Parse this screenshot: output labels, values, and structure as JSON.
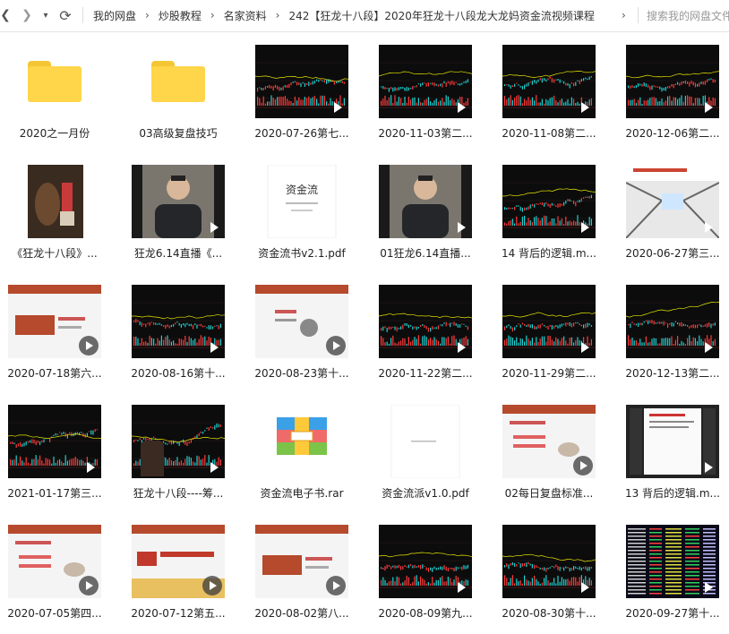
{
  "toolbar": {
    "back_icon": "chevron-left-icon",
    "forward_icon": "chevron-right-icon",
    "dropdown_icon": "triangle-down-icon",
    "refresh_icon": "refresh-icon",
    "breadcrumb": [
      "我的网盘",
      "炒股教程",
      "名家资料",
      "242【狂龙十八段】2020年狂龙十八段龙大龙妈资金流视频课程"
    ],
    "search_placeholder": "搜索我的网盘文件"
  },
  "items": [
    {
      "label": "2020之一月份",
      "type": "folder"
    },
    {
      "label": "03高级复盘技巧",
      "type": "folder"
    },
    {
      "label": "2020-07-26第七...",
      "type": "chart"
    },
    {
      "label": "2020-11-03第二...",
      "type": "chart"
    },
    {
      "label": "2020-11-08第二...",
      "type": "chart"
    },
    {
      "label": "2020-12-06第二...",
      "type": "chart"
    },
    {
      "label": "《狂龙十八段》...",
      "type": "image"
    },
    {
      "label": "狂龙6.14直播《...",
      "type": "person"
    },
    {
      "label": "资金流书v2.1.pdf",
      "type": "pdf"
    },
    {
      "label": "01狂龙6.14直播...",
      "type": "person"
    },
    {
      "label": "14 背后的逻辑.m...",
      "type": "chart"
    },
    {
      "label": "2020-06-27第三...",
      "type": "image2"
    },
    {
      "label": "2020-07-18第六...",
      "type": "ppt"
    },
    {
      "label": "2020-08-16第十...",
      "type": "chart"
    },
    {
      "label": "2020-08-23第十...",
      "type": "ppt2"
    },
    {
      "label": "2020-11-22第二...",
      "type": "chart"
    },
    {
      "label": "2020-11-29第二...",
      "type": "chart"
    },
    {
      "label": "2020-12-13第二...",
      "type": "chart"
    },
    {
      "label": "2021-01-17第三...",
      "type": "chart"
    },
    {
      "label": "狂龙十八段----筹...",
      "type": "chart2"
    },
    {
      "label": "资金流电子书.rar",
      "type": "rar"
    },
    {
      "label": "资金流派v1.0.pdf",
      "type": "pdf2"
    },
    {
      "label": "02每日复盘标准...",
      "type": "ppt3"
    },
    {
      "label": "13 背后的逻辑.m...",
      "type": "screen"
    },
    {
      "label": "2020-07-05第四...",
      "type": "ppt3"
    },
    {
      "label": "2020-07-12第五...",
      "type": "ppt4"
    },
    {
      "label": "2020-08-02第八...",
      "type": "ppt"
    },
    {
      "label": "2020-08-09第九...",
      "type": "chart"
    },
    {
      "label": "2020-08-30第十...",
      "type": "chart"
    },
    {
      "label": "2020-09-27第十...",
      "type": "table"
    }
  ],
  "thumb_text": {
    "pdf_title": "资金流"
  },
  "colors": {
    "folder": "#ffd54a",
    "chart_bg": "#0c0c0c",
    "ppt_accent": "#b54a2c"
  }
}
